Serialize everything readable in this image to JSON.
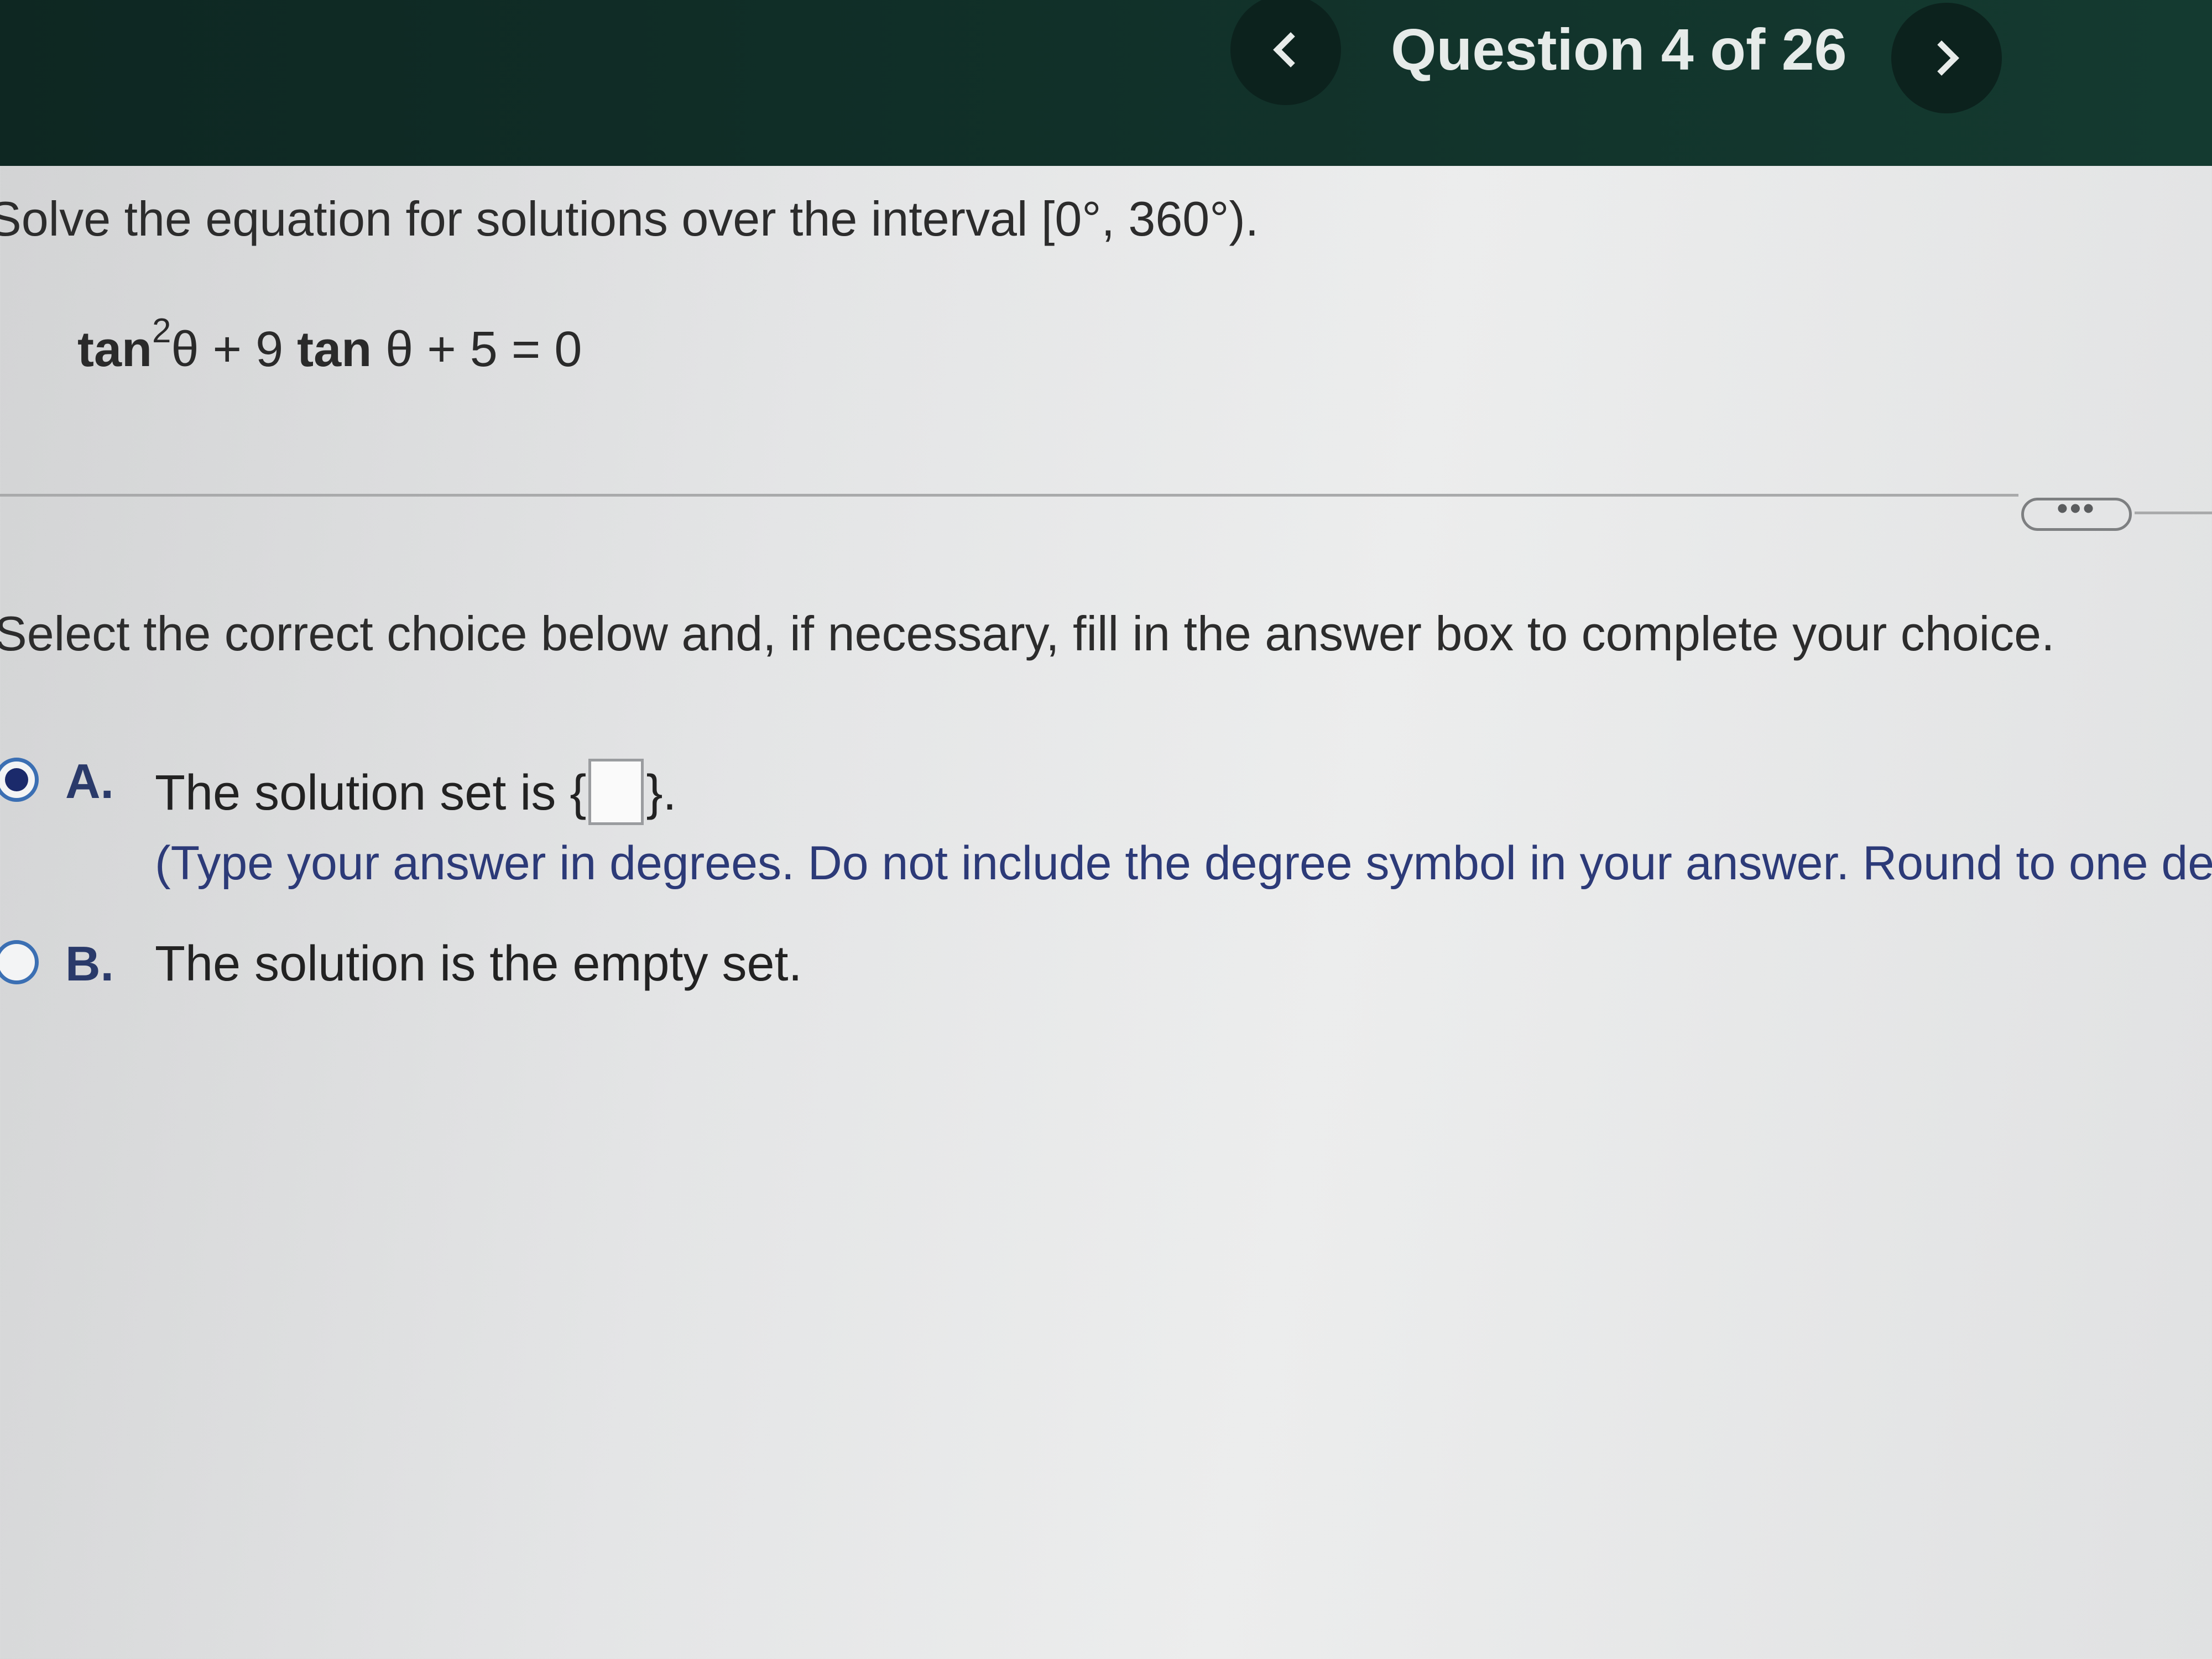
{
  "header": {
    "question_counter": "Question 4 of 26"
  },
  "problem": {
    "prompt": "Solve the equation for solutions over the interval [0°, 360°).",
    "equation": {
      "fn1": "tan",
      "exponent": "2",
      "part1": "θ + 9 ",
      "fn2": "tan",
      "part2": " θ + 5 = 0"
    }
  },
  "more_button": {
    "label": "•••"
  },
  "instruction": "Select the correct choice below and, if necessary, fill in the answer box to complete your choice.",
  "choices": [
    {
      "letter": "A.",
      "text_before": "The solution set is {",
      "text_after": "}.",
      "answer_value": "",
      "hint": "(Type your answer in degrees. Do not include the degree symbol in your answer. Round to one de",
      "selected": true
    },
    {
      "letter": "B.",
      "text": "The solution is the empty set.",
      "selected": false
    }
  ],
  "colors": {
    "header_bg": "#143a30",
    "radio_accent": "#3b6fb3",
    "hint_text": "#2c3a78"
  },
  "icons": {
    "prev": "chevron-left-icon",
    "next": "chevron-right-icon"
  }
}
